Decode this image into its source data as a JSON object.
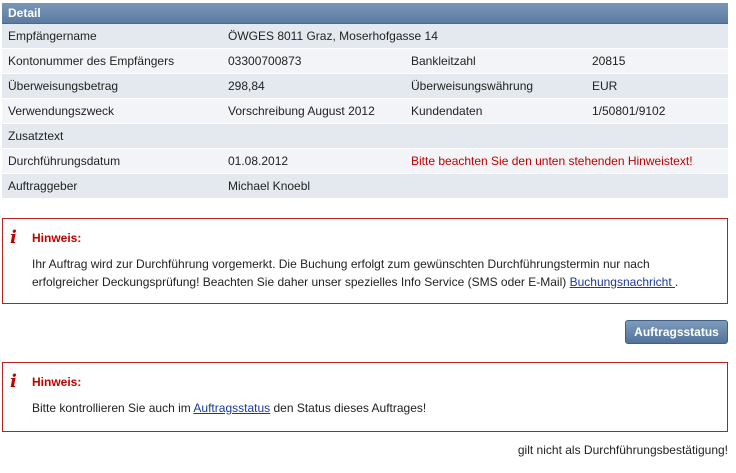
{
  "detail": {
    "header": "Detail",
    "rows": [
      {
        "label": "Empfängername",
        "value": "ÖWGES 8011 Graz, Moserhofgasse 14",
        "label2": "",
        "value2": ""
      },
      {
        "label": "Kontonummer des Empfängers",
        "value": "03300700873",
        "label2": "Bankleitzahl",
        "value2": "20815"
      },
      {
        "label": "Überweisungsbetrag",
        "value": "298,84",
        "label2": "Überweisungswährung",
        "value2": "EUR"
      },
      {
        "label": "Verwendungszweck",
        "value": "Vorschreibung August 2012",
        "label2": "Kundendaten",
        "value2": "1/50801/9102"
      },
      {
        "label": "Zusatztext",
        "value": "",
        "label2": "",
        "value2": ""
      },
      {
        "label": "Durchführungsdatum",
        "value": "01.08.2012",
        "label2": "Bitte beachten Sie den unten stehenden Hinweistext!",
        "value2": ""
      },
      {
        "label": "Auftraggeber",
        "value": "Michael Knoebl",
        "label2": "",
        "value2": ""
      }
    ]
  },
  "hint1": {
    "title": "Hinweis:",
    "text_before": "Ihr Auftrag wird zur Durchführung vorgemerkt. Die Buchung erfolgt zum gewünschten Durchführungstermin nur nach erfolgreicher Deckungsprüfung! Beachten Sie daher unser spezielles Info Service (SMS oder E-Mail) ",
    "link": "Buchungsnachricht ",
    "text_after": "."
  },
  "status_button": "Auftragsstatus",
  "hint2": {
    "title": "Hinweis:",
    "text_before": "Bitte kontrollieren Sie auch im ",
    "link": "Auftragsstatus",
    "text_after": " den Status dieses Auftrages!"
  },
  "footer_note": "gilt nicht als Durchführungsbestätigung!",
  "colors": {
    "header": "#5b7ba0",
    "warning": "#c00000",
    "link": "#1a3a9a"
  },
  "icons": {
    "hint": "info-icon"
  }
}
